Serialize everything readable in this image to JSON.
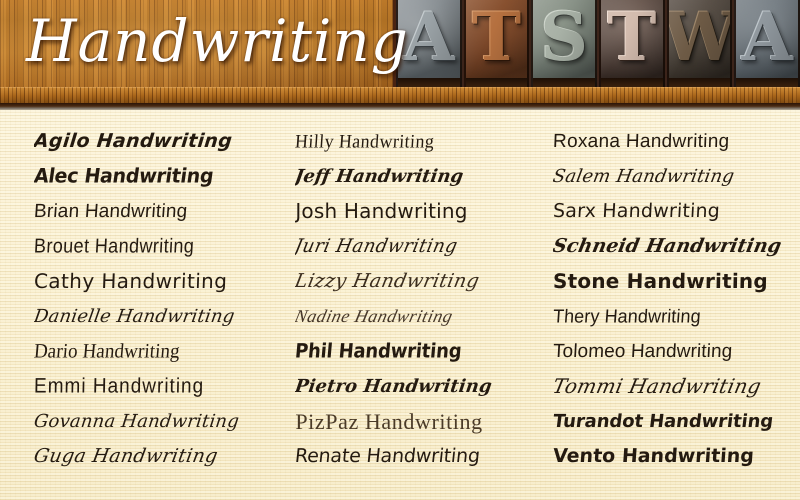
{
  "header": {
    "title": "Handwriting",
    "typeblocks": {
      "alt": "letterpress-type-blocks",
      "letters": [
        "A",
        "T",
        "S",
        "T",
        "W",
        "A"
      ]
    }
  },
  "colors": {
    "paper": "#f8eed0",
    "wood": "#b5701f",
    "title_text": "#ffffff",
    "sample_text": "#241a10",
    "header_band": "#2b1508"
  },
  "font_list": {
    "suffix": "Handwriting",
    "columns": [
      {
        "items": [
          {
            "name": "Agilo",
            "label": "Agilo Handwriting",
            "style": "s-agilo"
          },
          {
            "name": "Alec",
            "label": "Alec Handwriting",
            "style": "s-alec"
          },
          {
            "name": "Brian",
            "label": "Brian Handwriting",
            "style": "s-brian"
          },
          {
            "name": "Brouet",
            "label": "Brouet Handwriting",
            "style": "s-brouet"
          },
          {
            "name": "Cathy",
            "label": "Cathy Handwriting",
            "style": "s-cathy"
          },
          {
            "name": "Danielle",
            "label": "Danielle Handwriting",
            "style": "s-danielle"
          },
          {
            "name": "Dario",
            "label": "Dario Handwriting",
            "style": "s-dario"
          },
          {
            "name": "Emmi",
            "label": "Emmi Handwriting",
            "style": "s-emmi"
          },
          {
            "name": "Govanna",
            "label": "Govanna Handwriting",
            "style": "s-govanna"
          },
          {
            "name": "Guga",
            "label": "Guga Handwriting",
            "style": "s-guga"
          }
        ]
      },
      {
        "items": [
          {
            "name": "Hilly",
            "label": "Hilly Handwriting",
            "style": "s-hilly"
          },
          {
            "name": "Jeff",
            "label": "Jeff Handwriting",
            "style": "s-jeff"
          },
          {
            "name": "Josh",
            "label": "Josh Handwriting",
            "style": "s-josh"
          },
          {
            "name": "Juri",
            "label": "Juri Handwriting",
            "style": "s-juri"
          },
          {
            "name": "Lizzy",
            "label": "Lizzy Handwriting",
            "style": "s-lizzy"
          },
          {
            "name": "Nadine",
            "label": "Nadine Handwriting",
            "style": "s-nadine"
          },
          {
            "name": "Phil",
            "label": "Phil Handwriting",
            "style": "s-phil"
          },
          {
            "name": "Pietro",
            "label": "Pietro Handwriting",
            "style": "s-pietro"
          },
          {
            "name": "PizPaz",
            "label": "PizPaz Handwriting",
            "style": "s-pizpaz"
          },
          {
            "name": "Renate",
            "label": "Renate Handwriting",
            "style": "s-renate"
          }
        ]
      },
      {
        "items": [
          {
            "name": "Roxana",
            "label": "Roxana Handwriting",
            "style": "s-roxana"
          },
          {
            "name": "Salem",
            "label": "Salem Handwriting",
            "style": "s-salem"
          },
          {
            "name": "Sarx",
            "label": "Sarx Handwriting",
            "style": "s-sarx"
          },
          {
            "name": "Schneid",
            "label": "Schneid Handwriting",
            "style": "s-schneid"
          },
          {
            "name": "Stone",
            "label": "Stone Handwriting",
            "style": "s-stone"
          },
          {
            "name": "Thery",
            "label": "Thery Handwriting",
            "style": "s-thery"
          },
          {
            "name": "Tolomeo",
            "label": "Tolomeo Handwriting",
            "style": "s-tolomeo"
          },
          {
            "name": "Tommi",
            "label": "Tommi Handwriting",
            "style": "s-tommi"
          },
          {
            "name": "Turandot",
            "label": "Turandot Handwriting",
            "style": "s-turandot"
          },
          {
            "name": "Vento",
            "label": "Vento Handwriting",
            "style": "s-vento"
          }
        ]
      }
    ]
  }
}
